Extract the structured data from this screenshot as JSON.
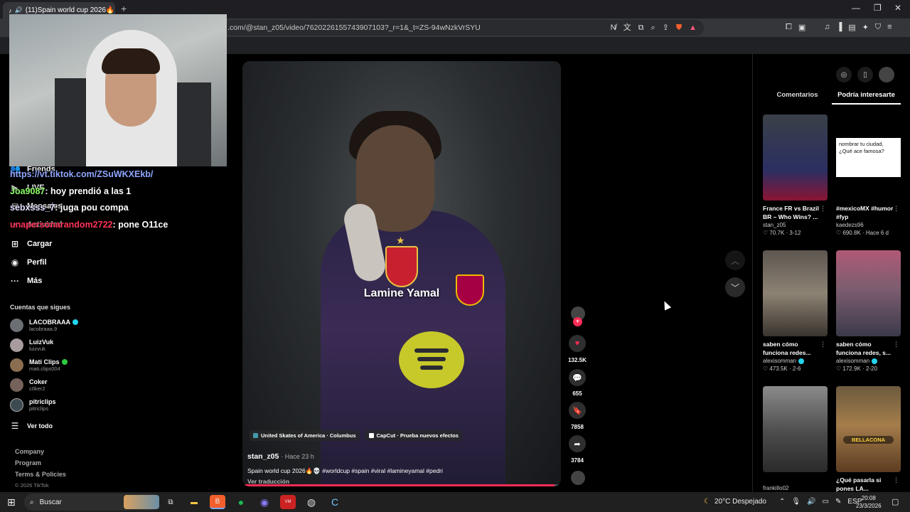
{
  "browser": {
    "tab_title": "(11)Spain world cup 2026🔥💀",
    "new_tab": "+",
    "url": ".com/@stan_z05/video/7620226155743907103?_r=1&_t=ZS-94wNzkVrSYU"
  },
  "sidebar": {
    "items": [
      {
        "icon": "friends-icon",
        "label": "Friends"
      },
      {
        "icon": "live-icon",
        "label": "LIVE"
      },
      {
        "icon": "messages-icon",
        "label": "Mensajes"
      },
      {
        "icon": "activity-icon",
        "label": "Actividad"
      },
      {
        "icon": "upload-icon",
        "label": "Cargar"
      },
      {
        "icon": "profile-icon",
        "label": "Perfil"
      },
      {
        "icon": "more-icon",
        "label": "Más"
      }
    ],
    "following_title": "Cuentas que sigues",
    "following": [
      {
        "name": "LACOBRAAA",
        "handle": "lacobraaa.9",
        "verified": "blue"
      },
      {
        "name": "LuizVuk",
        "handle": "luizvuk",
        "verified": ""
      },
      {
        "name": "Mati Clips",
        "handle": "mati.clips004",
        "verified": "green"
      },
      {
        "name": "Coker",
        "handle": "c0ker2",
        "verified": ""
      },
      {
        "name": "pitriclips",
        "handle": "pitriclips",
        "verified": ""
      }
    ],
    "see_all": "Ver todo",
    "footer": [
      "Company",
      "Program",
      "Terms & Policies"
    ],
    "copyright": "© 2026 TikTok"
  },
  "chat": {
    "link": "https://vt.tiktok.com/ZSuWKXEkb/",
    "messages": [
      {
        "user": "Joa9087",
        "text": ": hoy prendió a las 1"
      },
      {
        "user": "sebxsss_7",
        "text": ": juga pou compa"
      },
      {
        "user": "unapersonarandom2722",
        "text": ": pone O11ce"
      }
    ]
  },
  "video": {
    "overlay_name": "Lamine Yamal",
    "chip_location": "United Skates of America · Columbus",
    "chip_capcut": "CapCut · Prueba nuevos efectos",
    "author": "stan_z05",
    "time": "· Hace 23 h",
    "caption": "Spain world cup 2026🔥💀 #worldcup #spain #viral #lamineyamal #pedri",
    "translate": "Ver traducción",
    "progress": 0.98
  },
  "actions": {
    "likes": "132.5K",
    "comments": "655",
    "saves": "7858",
    "shares": "3784"
  },
  "right_panel": {
    "tab_comments": "Comentarios",
    "tab_interest": "Podría interesarte",
    "cards": [
      {
        "title": "France FR vs Brazil BR – Who Wins? ...",
        "author": "stan_z05",
        "likes": "70.7K",
        "date": "3-12",
        "verified": false
      },
      {
        "title": "#mexicoMX #humor #fyp",
        "author": "kaedezs96",
        "likes": "690.8K",
        "date": "Hace 6 d",
        "verified": false,
        "thumb_text": "nombrar tu ciudad, ¿Qué ace famosa?"
      },
      {
        "title": "saben cómo funciona redes...",
        "author": "alexisomman",
        "likes": "473.5K",
        "date": "2-6",
        "verified": true
      },
      {
        "title": "saben cómo funciona redes, s...",
        "author": "alexisomman",
        "likes": "172.9K",
        "date": "2-20",
        "verified": true
      },
      {
        "title": "",
        "author": "frankillo02",
        "likes": "",
        "date": "",
        "verified": false
      },
      {
        "title": "¿Qué pasarla si pones LA...",
        "author": "",
        "likes": "",
        "date": "",
        "verified": false,
        "thumb_text": "BELLACONA"
      }
    ]
  },
  "taskbar": {
    "search": "Buscar",
    "weather": "20°C  Despejado",
    "lang": "ESP",
    "time": "20:08",
    "date": "23/3/2026"
  }
}
